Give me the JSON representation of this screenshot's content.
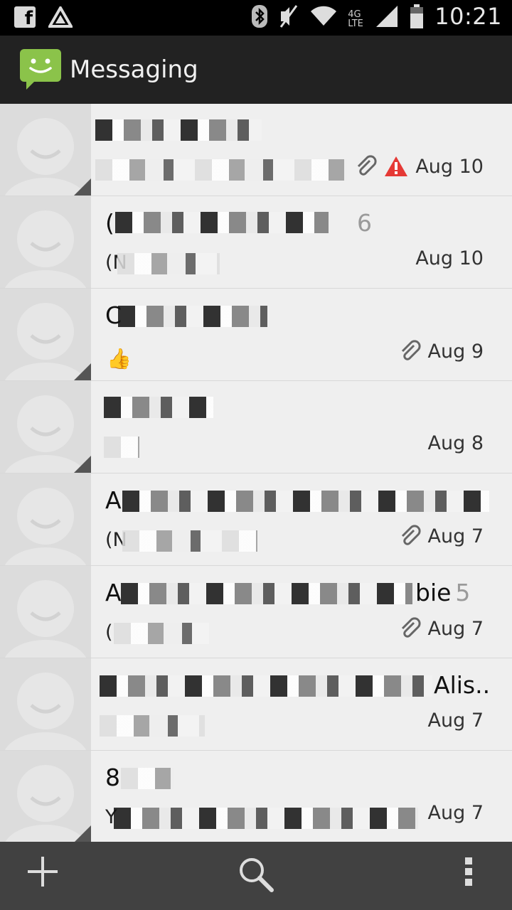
{
  "status_bar": {
    "time": "10:21",
    "network": "4G LTE",
    "icons": [
      "facebook-icon",
      "app-notification-icon",
      "bluetooth-icon",
      "mute-icon",
      "wifi-icon",
      "signal-icon",
      "battery-icon"
    ]
  },
  "action_bar": {
    "title": "Messaging",
    "icon": "messaging-app-icon"
  },
  "conversations": [
    {
      "name": "",
      "count": "",
      "snippet": "",
      "date": "Aug 10",
      "attachment": true,
      "error": true
    },
    {
      "name": "(",
      "count": "6",
      "snippet": "(N",
      "date": "Aug 10",
      "attachment": false,
      "error": false
    },
    {
      "name": "C",
      "count": "",
      "snippet": "",
      "date": "Aug 9",
      "attachment": true,
      "error": false
    },
    {
      "name": "",
      "count": "",
      "snippet": "",
      "date": "Aug 8",
      "attachment": false,
      "error": false
    },
    {
      "name": "A",
      "count": "",
      "snippet": "(N",
      "date": "Aug 7",
      "attachment": true,
      "error": false
    },
    {
      "name": "A",
      "name_tail": "bie",
      "count": "5",
      "snippet": "(",
      "date": "Aug 7",
      "attachment": true,
      "error": false
    },
    {
      "name": "",
      "name_tail": "Alis..",
      "count": "",
      "snippet": "",
      "date": "Aug 7",
      "attachment": false,
      "error": false
    },
    {
      "name": "8",
      "count": "",
      "snippet": "Y",
      "date": "Aug 7",
      "attachment": false,
      "error": false
    }
  ],
  "bottom_bar": {
    "new": "new-message-icon",
    "search": "search-icon",
    "menu": "overflow-menu-icon"
  },
  "colors": {
    "action_bar": "#222222",
    "list_bg": "#efefef",
    "avatar_bg": "#dcdcdc",
    "error": "#e53935",
    "bottom_bar": "#414141"
  }
}
